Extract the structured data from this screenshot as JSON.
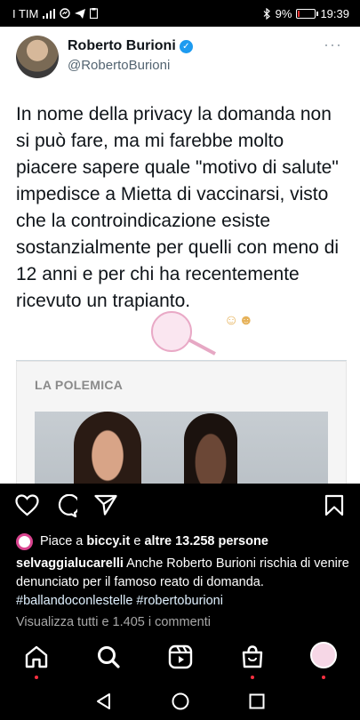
{
  "status_bar": {
    "carrier": "I TIM",
    "battery_percent": "9%",
    "battery_level": 0.09,
    "time": "19:39",
    "colors": {
      "battery_low": "#e33333"
    }
  },
  "tweet": {
    "author_name": "Roberto Burioni",
    "author_handle": "@RobertoBurioni",
    "more": "···",
    "text": "In nome della privacy la domanda non si può fare, ma mi farebbe molto piacere sapere quale \"motivo di salute\" impedisce a Mietta di vaccinarsi, visto che la controindicazione esiste sostanzialmente per quelli con meno di 12 anni e per chi ha recentemente ricevuto un trapianto.",
    "article_kicker": "LA POLEMICA",
    "icons": [
      "verified-badge-icon",
      "more-options-icon"
    ]
  },
  "post": {
    "likes_prefix": "Piace a",
    "likes_user": "biccy.it",
    "likes_middle": "e",
    "likes_count": "altre 13.258 persone",
    "caption_user": "selvaggialucarelli",
    "caption_text": "Anche Roberto Burioni rischia di venire denunciato per il famoso reato di domanda.",
    "caption_tags": "#ballandoconlestelle #robertoburioni",
    "comments_link": "Visualizza tutti e 1.405 i commenti",
    "icons": [
      "heart-icon",
      "comment-icon",
      "share-icon",
      "bookmark-icon"
    ]
  },
  "bottom_nav": {
    "icons": [
      "home-icon",
      "search-icon",
      "reels-icon",
      "shop-icon",
      "profile-avatar"
    ],
    "colors": {
      "notification": "#ff3040"
    }
  },
  "android_nav": {
    "icons": [
      "back-icon",
      "home-circle-icon",
      "recents-icon"
    ]
  }
}
